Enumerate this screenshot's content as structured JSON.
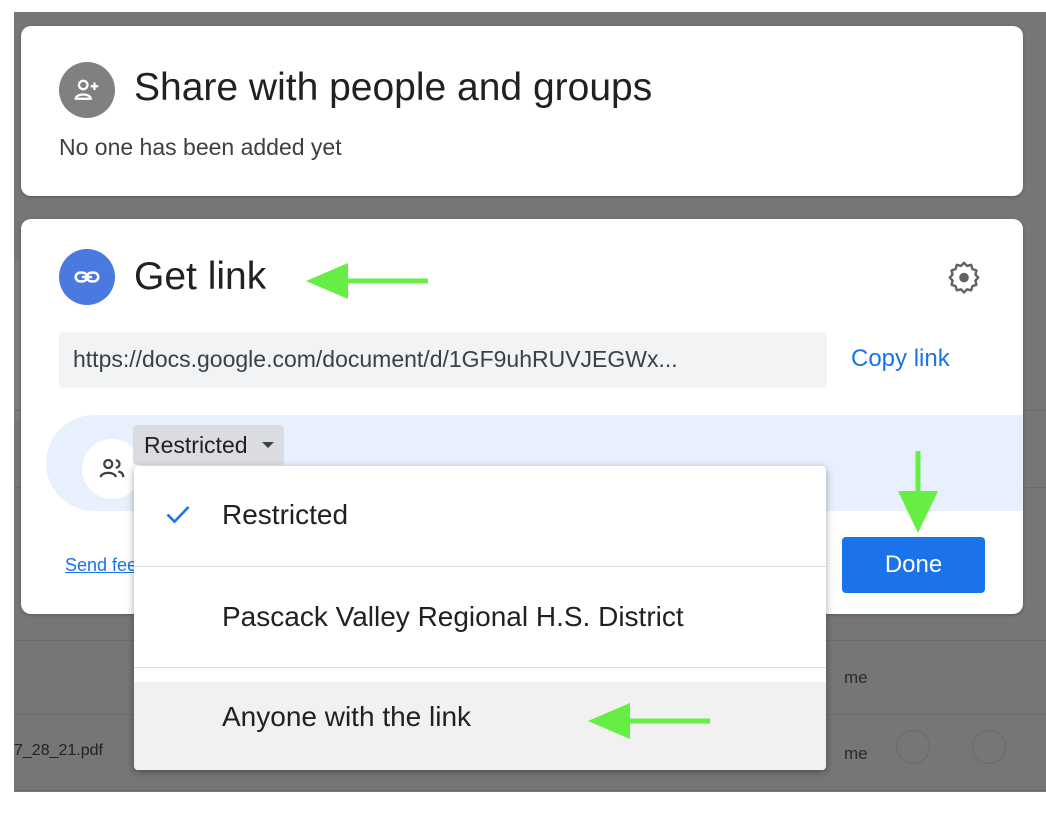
{
  "colors": {
    "accent": "#1a73e8",
    "link_icon_bg": "#4a79e0",
    "share_icon_bg": "#808080",
    "annotation_arrow": "#66ee44"
  },
  "share": {
    "title": "Share with people and groups",
    "subtitle": "No one has been added yet",
    "icon": "person-add-icon"
  },
  "get_link": {
    "title": "Get link",
    "icon": "link-icon",
    "settings_icon": "gear-icon",
    "url": "https://docs.google.com/document/d/1GF9uhRUVJEGWx...",
    "copy_label": "Copy link",
    "access_icon": "people-icon",
    "access_selected": "Restricted",
    "send_feedback": "Send feedback",
    "done_label": "Done"
  },
  "dropdown": {
    "options": [
      {
        "label": "Restricted",
        "selected": true,
        "icon": "check-icon"
      },
      {
        "label": "Pascack Valley Regional H.S. District",
        "selected": false
      },
      {
        "label": "Anyone with the link",
        "selected": false,
        "hovered": true
      }
    ]
  },
  "background": {
    "file_name_fragment": "7_28_21.pdf",
    "owner_rows": [
      "me",
      "me"
    ]
  }
}
